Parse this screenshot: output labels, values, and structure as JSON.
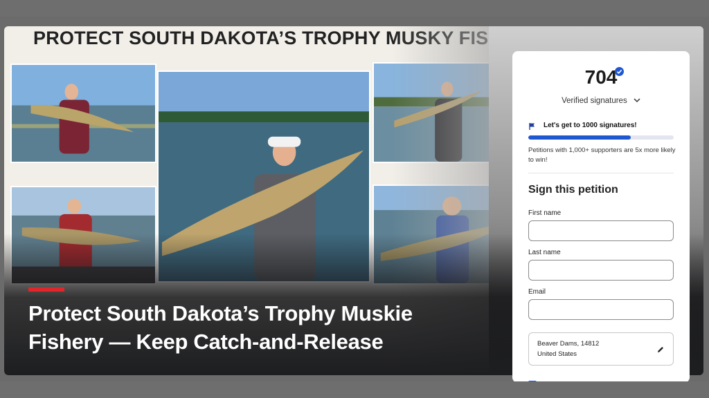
{
  "banner": {
    "title": "PROTECT SOUTH DAKOTA’S TROPHY MUSKY FISHERY"
  },
  "headline": {
    "line1": "Protect South Dakota’s Trophy Muskie",
    "line2": "Fishery — Keep Catch-and-Release"
  },
  "petition": {
    "signature_count": "704",
    "signatures_label": "Verified signatures",
    "goal_text": "Let's get to 1000 signatures!",
    "progress_fraction": 0.704,
    "note": "Petitions with 1,000+ supporters are 5x more likely to win!",
    "sign_title": "Sign this petition",
    "fields": {
      "first_name_label": "First name",
      "last_name_label": "Last name",
      "email_label": "Email"
    },
    "location": {
      "line1": "Beaver Dams, 14812",
      "line2": "United States"
    }
  },
  "colors": {
    "accent": "#1f57d1",
    "headline_bar": "#e0262a"
  },
  "icons": {
    "verified": "verified-badge-icon",
    "dropdown": "chevron-down-icon",
    "goal": "flag-icon",
    "edit": "pencil-icon"
  }
}
